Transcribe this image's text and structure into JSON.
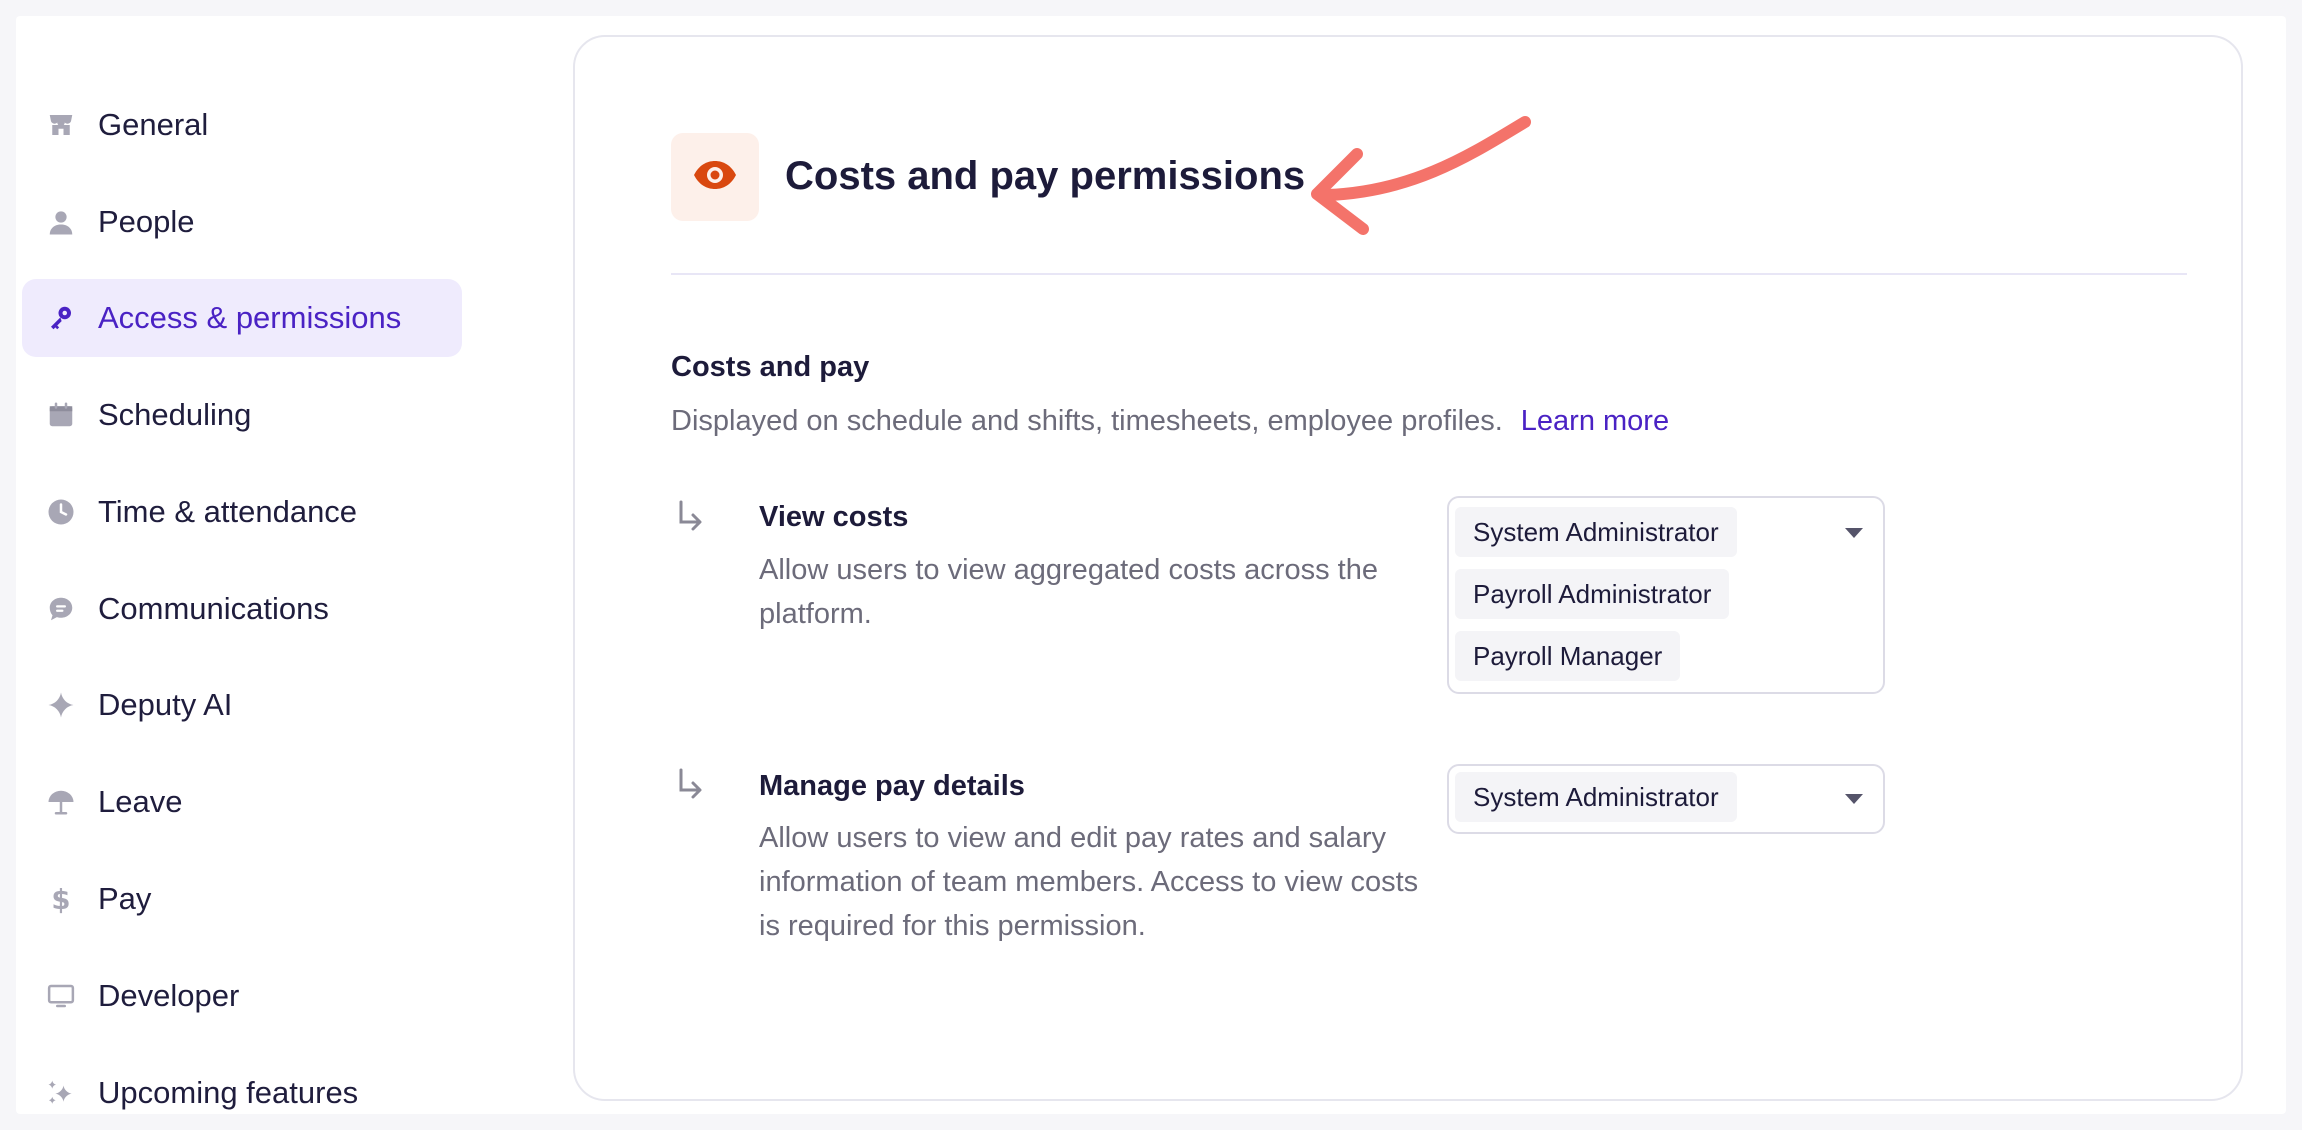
{
  "sidebar": {
    "items": [
      {
        "label": "General",
        "icon": "store-icon"
      },
      {
        "label": "People",
        "icon": "person-icon"
      },
      {
        "label": "Access & permissions",
        "icon": "key-icon",
        "active": true
      },
      {
        "label": "Scheduling",
        "icon": "calendar-icon"
      },
      {
        "label": "Time & attendance",
        "icon": "clock-icon"
      },
      {
        "label": "Communications",
        "icon": "chat-bubble-icon"
      },
      {
        "label": "Deputy AI",
        "icon": "sparkle-icon"
      },
      {
        "label": "Leave",
        "icon": "umbrella-icon"
      },
      {
        "label": "Pay",
        "icon": "dollar-icon"
      },
      {
        "label": "Developer",
        "icon": "monitor-icon"
      },
      {
        "label": "Upcoming features",
        "icon": "stars-icon"
      }
    ]
  },
  "main": {
    "title": "Costs and pay permissions",
    "header_icon": "eye-icon",
    "section": {
      "title": "Costs and pay",
      "description": "Displayed on schedule and shifts, timesheets, employee profiles.",
      "learn_more": "Learn more"
    },
    "permissions": [
      {
        "title": "View costs",
        "description": "Allow users to view aggregated costs across the platform.",
        "roles": [
          "System Administrator",
          "Payroll Administrator",
          "Payroll Manager"
        ]
      },
      {
        "title": "Manage pay details",
        "description": "Allow users to view and edit pay rates and salary information of team members. Access to view costs is required for this permission.",
        "roles": [
          "System Administrator"
        ]
      }
    ]
  },
  "colors": {
    "accent": "#4a22c4",
    "active_bg": "#efebfd",
    "eye_icon": "#d9480f",
    "annotation_arrow": "#f4736a",
    "icon_gray": "#a8a7b5"
  }
}
